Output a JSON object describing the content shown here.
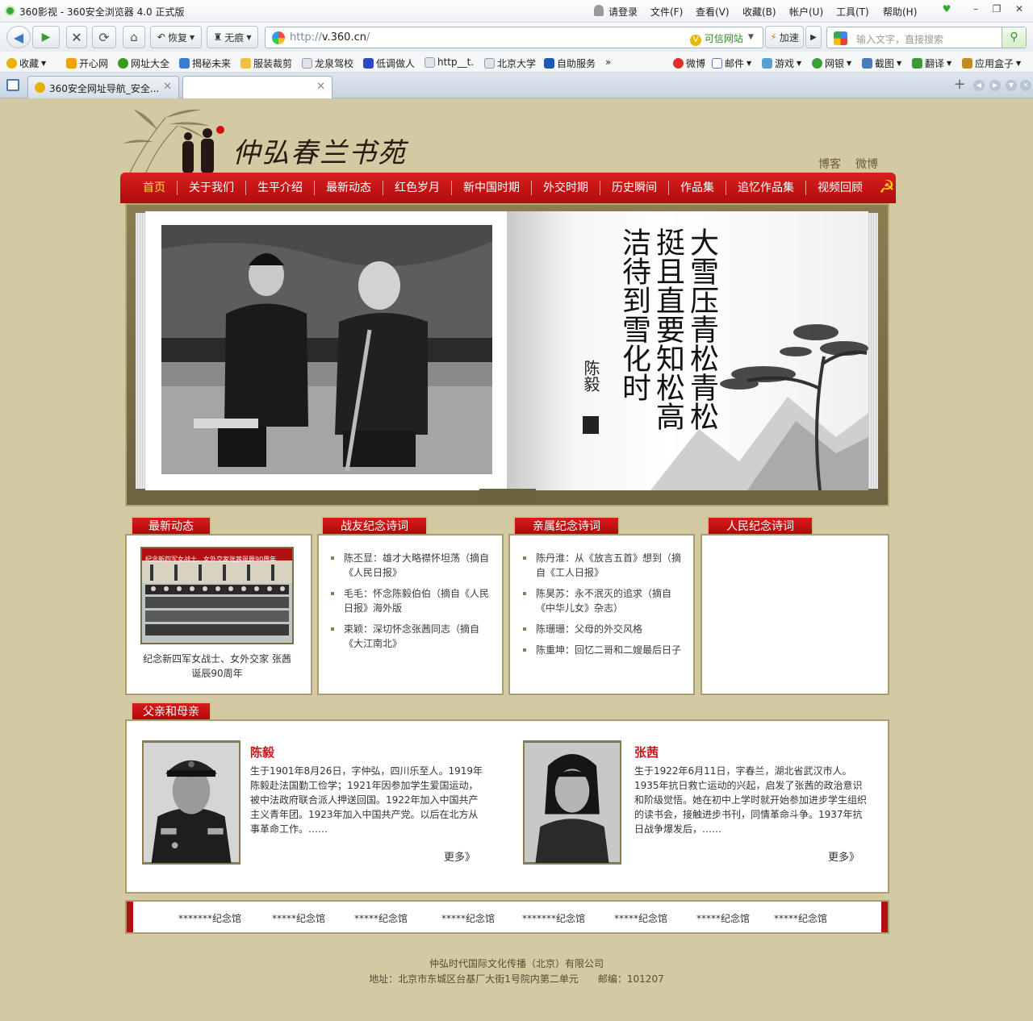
{
  "browser": {
    "window_title": "360影视 - 360安全浏览器 4.0 正式版",
    "menu": [
      "请登录",
      "文件(F)",
      "查看(V)",
      "收藏(B)",
      "帐户(U)",
      "工具(T)",
      "帮助(H)"
    ],
    "restore_label": "恢复",
    "incognito_label": "无痕",
    "url_prefix": "http://",
    "url_host": "v.360.cn",
    "url_suffix": "/",
    "trust_label": "可信网站",
    "speed_label": "加速",
    "search_placeholder": "输入文字，直接搜索",
    "favorites": [
      "收藏",
      "开心网",
      "网址大全",
      "揭秘未来",
      "服装裁剪",
      "龙泉驾校",
      "低调做人",
      "http__t.",
      "北京大学",
      "自助服务"
    ],
    "tools": [
      "微博",
      "邮件",
      "游戏",
      "网银",
      "截图",
      "翻译",
      "应用盒子"
    ],
    "tabs": [
      "360安全网址导航_安全...",
      ""
    ]
  },
  "site": {
    "title": "仲弘春兰书苑",
    "toplinks": [
      "博客",
      "微博"
    ],
    "nav": [
      "首页",
      "关于我们",
      "生平介绍",
      "最新动态",
      "红色岁月",
      "新中国时期",
      "外交时期",
      "历史瞬间",
      "作品集",
      "追忆作品集",
      "视频回顾"
    ],
    "calligraphy": "大雪压青松青松挺且直要知松高洁待到雪化时",
    "calligraphy_sign": "陈毅"
  },
  "sections": {
    "news": {
      "label": "最新动态",
      "banner": "纪念新四军女战士、女外交家张茜诞辰90周年",
      "caption": "纪念新四军女战士、女外交家 张茜诞辰90周年"
    },
    "comrades": {
      "label": "战友纪念诗词",
      "items": [
        "陈丕显：雄才大略襟怀坦荡（摘自《人民日报》",
        "毛毛：怀念陈毅伯伯（摘自《人民日报》海外版",
        "束颖：深切怀念张茜同志（摘自《大江南北》"
      ]
    },
    "relatives": {
      "label": "亲属纪念诗词",
      "items": [
        "陈丹淮：从《放言五首》想到（摘自《工人日报》",
        "陈昊苏：永不泯灭的追求（摘自《中华儿女》杂志）",
        "陈珊珊：父母的外交风格",
        "陈重坤：回忆二哥和二嫂最后日子"
      ]
    },
    "people": {
      "label": "人民纪念诗词"
    },
    "parents": {
      "label": "父亲和母亲",
      "father": {
        "name": "陈毅",
        "bio": "生于1901年8月26日，字仲弘，四川乐至人。1919年陈毅赴法国勤工俭学；1921年因参加学生爱国运动，被中法政府联合派人押送回国。1922年加入中国共产主义青年团。1923年加入中国共产党。以后在北方从事革命工作。……",
        "more": "更多》"
      },
      "mother": {
        "name": "张茜",
        "bio": "生于1922年6月11日，字春兰，湖北省武汉市人。1935年抗日救亡运动的兴起，启发了张茜的政治意识和阶级觉悟。她在初中上学时就开始参加进步学生组织的读书会，接触进步书刊，同情革命斗争。1937年抗日战争爆发后，……",
        "more": "更多》"
      }
    }
  },
  "links": [
    "*******纪念馆",
    "*****纪念馆",
    "*****纪念馆",
    "*****纪念馆",
    "*******纪念馆",
    "*****纪念馆",
    "*****纪念馆",
    "*****纪念馆"
  ],
  "footer": {
    "company": "仲弘时代国际文化传播（北京）有限公司",
    "address": "地址：北京市东城区台基厂大街1号院内第二单元　　邮编：101207"
  }
}
